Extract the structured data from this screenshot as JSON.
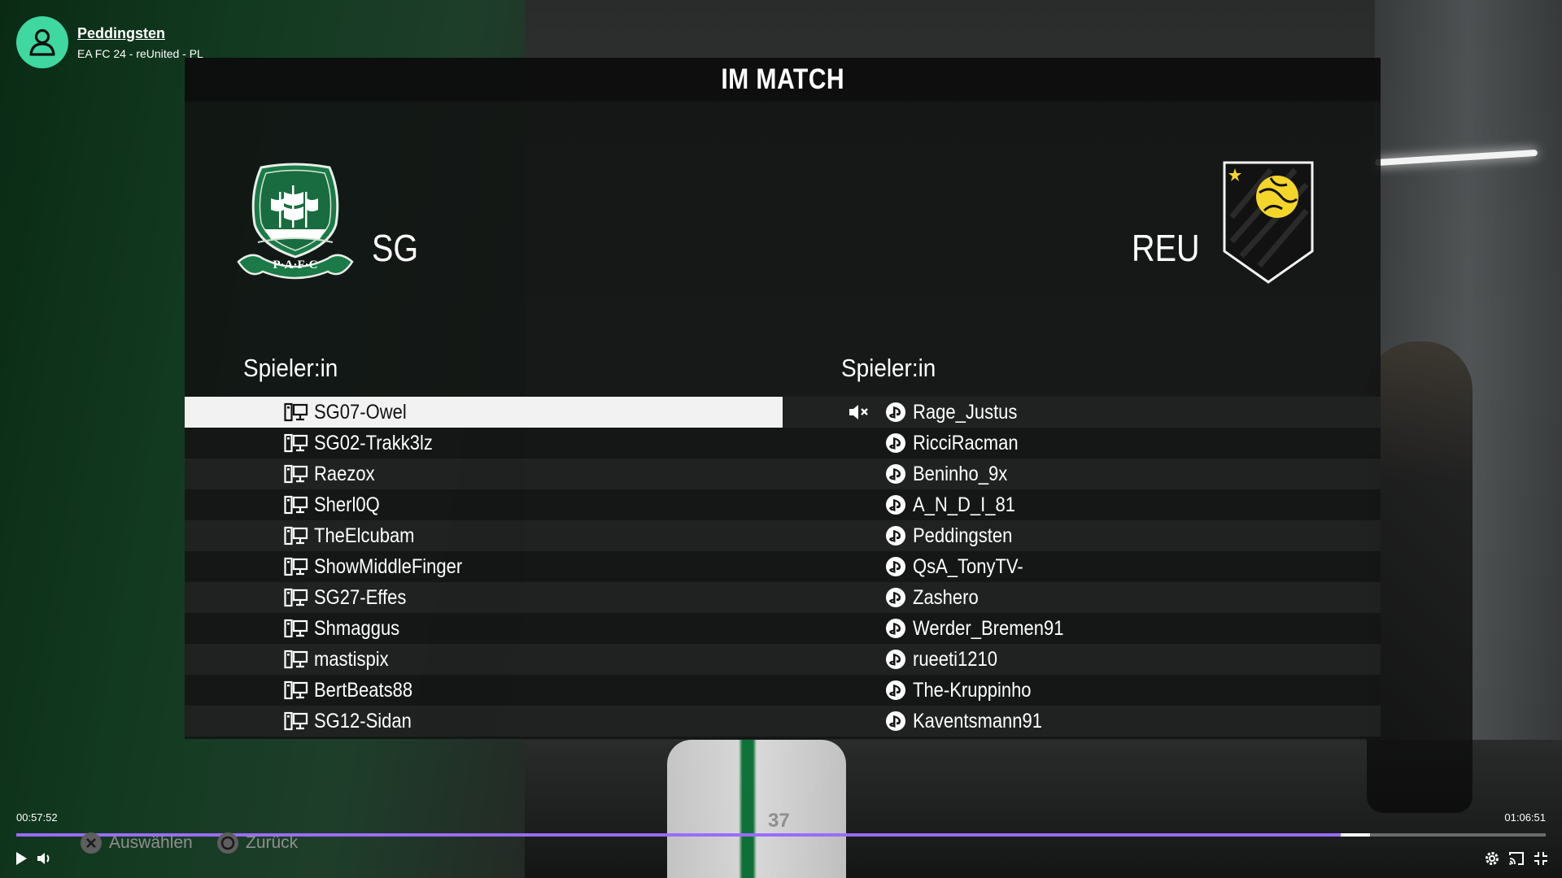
{
  "channel": {
    "name": "Peddingsten",
    "subtitle": "EA FC 24 - reUnited - PL"
  },
  "panel": {
    "title": "IM MATCH",
    "left_team": {
      "abbr": "SG",
      "crest_text": "P·A·F·C",
      "crest_color": "#1b7a47"
    },
    "right_team": {
      "abbr": "REU",
      "crest_color": "#121212"
    },
    "left_column_header": "Spieler:in",
    "right_column_header": "Spieler:in",
    "left_players": [
      {
        "name": "SG07-Owel",
        "platform": "pc-icon",
        "selected": true
      },
      {
        "name": "SG02-Trakk3lz",
        "platform": "pc-icon"
      },
      {
        "name": "Raezox",
        "platform": "pc-icon"
      },
      {
        "name": "Sherl0Q",
        "platform": "pc-icon"
      },
      {
        "name": "TheElcubam",
        "platform": "pc-icon"
      },
      {
        "name": "ShowMiddleFinger",
        "platform": "pc-icon"
      },
      {
        "name": "SG27-Effes",
        "platform": "pc-icon"
      },
      {
        "name": "Shmaggus",
        "platform": "pc-icon"
      },
      {
        "name": "mastispix",
        "platform": "pc-icon"
      },
      {
        "name": "BertBeats88",
        "platform": "pc-icon"
      },
      {
        "name": "SG12-Sidan",
        "platform": "pc-icon"
      }
    ],
    "right_players": [
      {
        "name": "Rage_Justus",
        "platform": "playstation-icon",
        "muted": true
      },
      {
        "name": "RicciRacman",
        "platform": "playstation-icon"
      },
      {
        "name": "Beninho_9x",
        "platform": "playstation-icon"
      },
      {
        "name": "A_N_D_I_81",
        "platform": "playstation-icon"
      },
      {
        "name": "Peddingsten",
        "platform": "playstation-icon"
      },
      {
        "name": "QsA_TonyTV-",
        "platform": "playstation-icon"
      },
      {
        "name": "Zashero",
        "platform": "playstation-icon"
      },
      {
        "name": "Werder_Bremen91",
        "platform": "playstation-icon"
      },
      {
        "name": "rueeti1210",
        "platform": "playstation-icon"
      },
      {
        "name": "The-Kruppinho",
        "platform": "playstation-icon"
      },
      {
        "name": "Kaventsmann91",
        "platform": "playstation-icon"
      }
    ]
  },
  "hints": {
    "select_label": "Auswählen",
    "back_label": "Zurück"
  },
  "scene": {
    "jersey_number": "37"
  },
  "player": {
    "current_time": "00:57:52",
    "total_time": "01:06:51",
    "progress_fraction": 0.8659,
    "buffer_end_fraction": 0.885,
    "accent_color": "#9b6cff"
  }
}
